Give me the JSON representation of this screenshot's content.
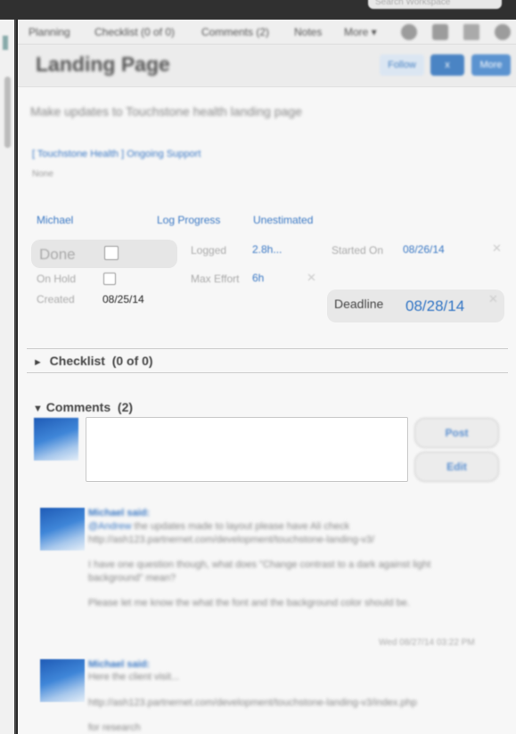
{
  "chrome": {
    "search_placeholder": "Search Workspace"
  },
  "tabs": [
    "Planning",
    "Checklist (0 of 0)",
    "Comments (2)",
    "Notes",
    "More ▾"
  ],
  "header": {
    "title": "Landing Page",
    "follow_label": "Follow",
    "x_label": "x",
    "more_label": "More"
  },
  "task": {
    "description": "Make updates to Touchstone health landing page",
    "project_link": "[ Touchstone Health ] Ongoing Support",
    "project_sub": "None"
  },
  "assign": {
    "assignee": "Michael",
    "log_progress": "Log Progress",
    "estimate": "Unestimated"
  },
  "fields": {
    "done_label": "Done",
    "logged_label": "Logged",
    "logged_value": "2.8h...",
    "started_label": "Started On",
    "started_value": "08/26/14",
    "on_hold_label": "On Hold",
    "max_effort_label": "Max Effort",
    "max_effort_value": "6h",
    "created_label": "Created",
    "created_value": "08/25/14",
    "deadline_label": "Deadline",
    "deadline_value": "08/28/14"
  },
  "checklist": {
    "title": "Checklist",
    "count": "(0 of 0)",
    "arrow": "►"
  },
  "comments": {
    "title": "Comments",
    "count": "(2)",
    "arrow": "▼",
    "post_label": "Post",
    "edit_label": "Edit",
    "items": [
      {
        "author": "Michael said:",
        "mention": "@Andrew",
        "line1": " the updates made to layout please have Ali check",
        "line2": "http://ash123.partnernet.com/development/touchstone-landing-v3/",
        "line3": "I have one question though, what does \"Change contrast to a dark against light",
        "line4": "background\" mean?",
        "line5": "Please let me know the what the font and the background color should be.",
        "timestamp": "Wed 08/27/14 03:22 PM"
      },
      {
        "author": "Michael said:",
        "line1": "Here the client visit...",
        "line2": "http://ash123.partnernet.com/development/touchstone-landing-v3/index.php",
        "line3": "for research"
      }
    ]
  },
  "colors": {
    "link": "#3a78c4",
    "deadline": "#2f73c4",
    "panel": "#f7f7f7"
  },
  "icons": [
    "gear-icon",
    "print-icon",
    "expand-icon",
    "settings-icon"
  ]
}
